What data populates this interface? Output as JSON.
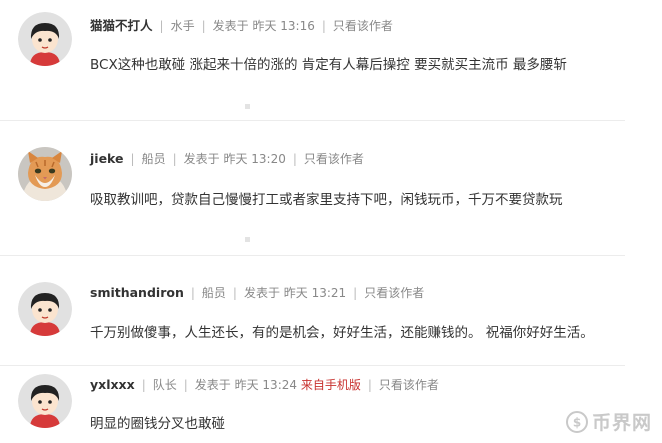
{
  "posts": [
    {
      "username": "猫猫不打人",
      "rank": "水手",
      "posted": "发表于  昨天 13:16",
      "only_author": "只看该作者",
      "mobile": "",
      "content": "BCX这种也敢碰 涨起来十倍的涨的 肯定有人幕后操控   要买就买主流币 最多腰斩",
      "avatar_icon": "cartoon-avatar-icon"
    },
    {
      "username": "jieke",
      "rank": "船员",
      "posted": "发表于  昨天 13:20",
      "only_author": "只看该作者",
      "mobile": "",
      "content": "吸取教训吧，贷款自己慢慢打工或者家里支持下吧，闲钱玩币，千万不要贷款玩",
      "avatar_icon": "cat-photo-avatar-icon"
    },
    {
      "username": "smithandiron",
      "rank": "船员",
      "posted": "发表于  昨天 13:21",
      "only_author": "只看该作者",
      "mobile": "",
      "content": "千万别做傻事，人生还长，有的是机会，好好生活，还能赚钱的。   祝福你好好生活。",
      "avatar_icon": "cartoon-avatar-icon"
    },
    {
      "username": "yxlxxx",
      "rank": "队长",
      "posted": "发表于  昨天 13:24",
      "only_author": "只看该作者",
      "mobile": "来自手机版",
      "content": "明显的圈钱分叉也敢碰",
      "avatar_icon": "cartoon-avatar-icon"
    }
  ],
  "watermark": {
    "text": "币界网",
    "icon": "coin-logo-icon"
  },
  "colors": {
    "mobile_link": "#c8322f",
    "meta": "#888888",
    "divider": "#ececec"
  }
}
